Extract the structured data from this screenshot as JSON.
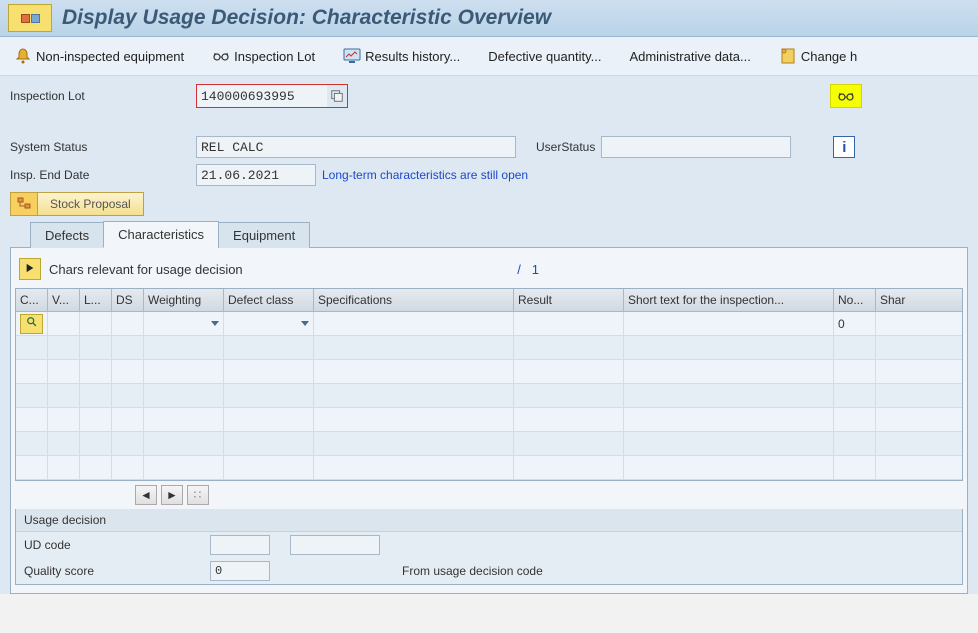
{
  "title": "Display Usage Decision: Characteristic Overview",
  "toolbar": {
    "non_inspected": "Non-inspected equipment",
    "inspection_lot": "Inspection Lot",
    "results_history": "Results history...",
    "defective_qty": "Defective quantity...",
    "admin_data": "Administrative data...",
    "change_h": "Change h"
  },
  "fields": {
    "inspection_lot_label": "Inspection Lot",
    "inspection_lot_value": "140000693995",
    "system_status_label": "System Status",
    "system_status_value": "REL  CALC",
    "user_status_label": "UserStatus",
    "user_status_value": "",
    "insp_end_date_label": "Insp. End Date",
    "insp_end_date_value": "21.06.2021",
    "long_term_msg": "Long-term characteristics are still open",
    "stock_proposal": "Stock Proposal"
  },
  "tabs": {
    "defects": "Defects",
    "characteristics": "Characteristics",
    "equipment": "Equipment"
  },
  "subbar": {
    "label": "Chars relevant for usage decision",
    "count_prefix": "/",
    "count": "1"
  },
  "grid": {
    "headers": {
      "c": "C...",
      "v": "V...",
      "l": "L...",
      "ds": "DS",
      "weighting": "Weighting",
      "defect_class": "Defect class",
      "specifications": "Specifications",
      "result": "Result",
      "short_text": "Short text for the inspection...",
      "no": "No...",
      "share": "Shar"
    },
    "rows": [
      {
        "no": "0"
      }
    ]
  },
  "ud": {
    "panel_title": "Usage decision",
    "ud_code_label": "UD code",
    "quality_score_label": "Quality score",
    "quality_score_value": "0",
    "from_code_label": "From usage decision code"
  }
}
